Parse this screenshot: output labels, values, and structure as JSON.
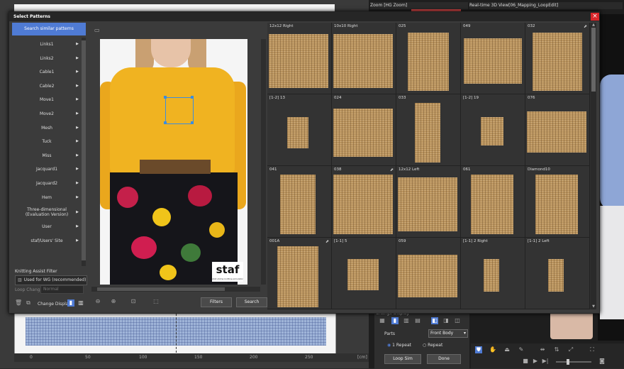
{
  "background": {
    "zoom_view_title": "Zoom [HG Zoom]",
    "view3d_title": "Real-time 3D View[06_Mapping_LoopEdit]",
    "bottom_panel": {
      "change_display": "Change Display",
      "parts_label": "Parts",
      "parts_value": "Front Body",
      "repeat1": "1 Repeat",
      "repeat2": "Repeat",
      "loop_sim": "Loop Sim",
      "done": "Done"
    },
    "ruler": [
      "0",
      "50",
      "100",
      "150",
      "200",
      "250",
      "[cm]"
    ]
  },
  "dialog": {
    "title": "Select Patterns",
    "close": "×",
    "search_similar": "Search similar patterns",
    "nav_items": [
      "Links1",
      "Links2",
      "Cable1",
      "Cable2",
      "Move1",
      "Move2",
      "Mesh",
      "Tuck",
      "Miss",
      "Jacquard1",
      "Jacquard2",
      "Hem",
      "Three-dimensional (Evaluation Version)",
      "User",
      "staf/Users' Site"
    ],
    "knitting_filter_label": "Knitting Assist Filter",
    "knitting_filter_value": "Used for WG (recommended)",
    "loop_change_label": "Loop Change",
    "loop_change_value": "Normal",
    "change_display_label": "Change Display",
    "filters_button": "Filters",
    "search_button": "Search",
    "logo_text": "staf",
    "logo_sub": "stoll shima knitting simulator",
    "patterns": [
      {
        "label": "12x12 Right",
        "ext": false
      },
      {
        "label": "10x10 Right",
        "ext": false
      },
      {
        "label": "025",
        "ext": false
      },
      {
        "label": "049",
        "ext": false
      },
      {
        "label": "032",
        "ext": true
      },
      {
        "label": "[1-2] 13",
        "ext": false
      },
      {
        "label": "024",
        "ext": false
      },
      {
        "label": "033",
        "ext": false
      },
      {
        "label": "[1-2] 19",
        "ext": false
      },
      {
        "label": "076",
        "ext": false
      },
      {
        "label": "041",
        "ext": false
      },
      {
        "label": "038",
        "ext": true
      },
      {
        "label": "12x12 Left",
        "ext": false
      },
      {
        "label": "061",
        "ext": false
      },
      {
        "label": "Diamond10",
        "ext": false
      },
      {
        "label": "001A",
        "ext": true
      },
      {
        "label": "[1-1] 5",
        "ext": false
      },
      {
        "label": "059",
        "ext": false
      },
      {
        "label": "[1-1] 2 Right",
        "ext": false
      },
      {
        "label": "[1-1] 2 Left",
        "ext": false
      }
    ]
  },
  "colors": {
    "accent": "#4f7bd4",
    "close_red": "#d9262a",
    "knit": "#b8925c",
    "sweater": "#f0b321"
  }
}
